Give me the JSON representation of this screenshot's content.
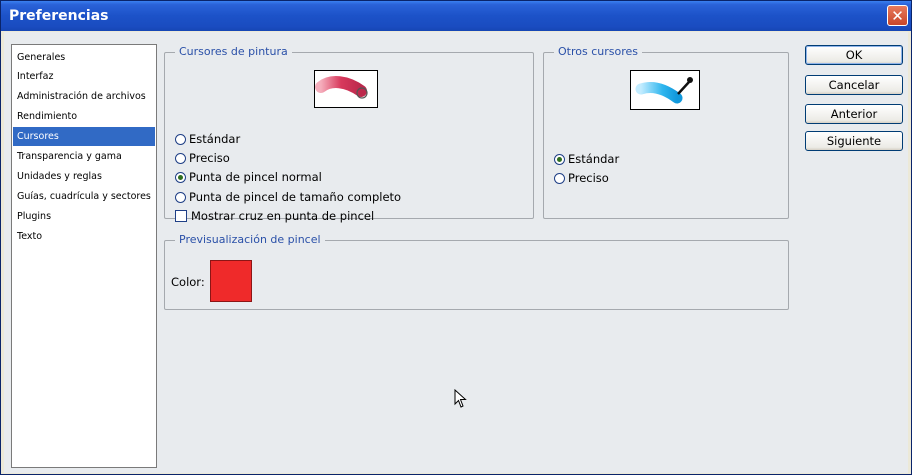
{
  "window": {
    "title": "Preferencias"
  },
  "sidebar": {
    "items": [
      {
        "label": "Generales",
        "selected": false
      },
      {
        "label": "Interfaz",
        "selected": false
      },
      {
        "label": "Administración de archivos",
        "selected": false
      },
      {
        "label": "Rendimiento",
        "selected": false
      },
      {
        "label": "Cursores",
        "selected": true
      },
      {
        "label": "Transparencia y gama",
        "selected": false
      },
      {
        "label": "Unidades y reglas",
        "selected": false
      },
      {
        "label": "Guías, cuadrícula y sectores",
        "selected": false
      },
      {
        "label": "Plugins",
        "selected": false
      },
      {
        "label": "Texto",
        "selected": false
      }
    ]
  },
  "painting_cursors": {
    "title": "Cursores de pintura",
    "options": [
      {
        "label": "Estándar",
        "checked": false
      },
      {
        "label": "Preciso",
        "checked": false
      },
      {
        "label": "Punta de pincel normal",
        "checked": true
      },
      {
        "label": "Punta de pincel de tamaño completo",
        "checked": false
      }
    ],
    "crosshair_label": "Mostrar cruz en punta de pincel",
    "crosshair_checked": false
  },
  "other_cursors": {
    "title": "Otros cursores",
    "options": [
      {
        "label": "Estándar",
        "checked": true
      },
      {
        "label": "Preciso",
        "checked": false
      }
    ]
  },
  "brush_preview": {
    "title": "Previsualización de pincel",
    "color_label": "Color:",
    "color": "#ef2a2a"
  },
  "buttons": {
    "ok": "OK",
    "cancel": "Cancelar",
    "previous": "Anterior",
    "next": "Siguiente"
  },
  "colors": {
    "titlebar": "#1c52c8",
    "selection": "#316ac5",
    "group_title": "#2a50a8"
  }
}
